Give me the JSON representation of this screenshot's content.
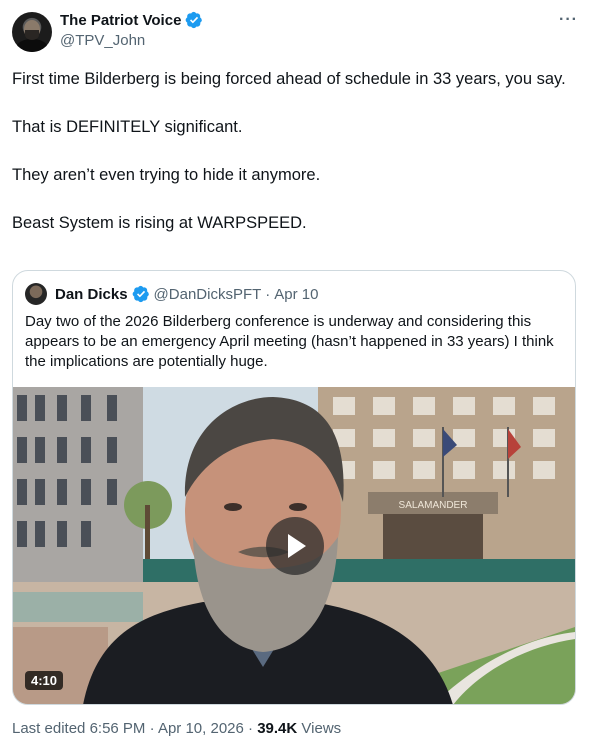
{
  "author": {
    "display_name": "The Patriot Voice",
    "handle": "@TPV_John",
    "verified_icon": "verified-badge-icon",
    "more_icon": "ellipsis-icon"
  },
  "tweet": {
    "paragraphs": [
      "First time Bilderberg is being forced ahead of schedule in 33 years, you say.",
      "That is DEFINITELY significant.",
      "They aren’t even trying to hide it anymore.",
      "Beast System is rising at WARPSPEED."
    ]
  },
  "quote": {
    "display_name": "Dan Dicks",
    "handle": "@DanDicksPFT",
    "separator": "·",
    "date": "Apr 10",
    "text": "Day two of the 2026 Bilderberg conference is underway and considering this appears to be an emergency April meeting (hasn’t happened in 33 years) I think the implications are potentially huge.",
    "video": {
      "duration": "4:10",
      "sign_text": "SALAMANDER",
      "play_icon": "play-icon"
    }
  },
  "footer": {
    "edited_label": "Last edited",
    "time": "6:56 PM",
    "separator": "·",
    "date": "Apr 10, 2026",
    "separator2": "·",
    "views_count": "39.4K",
    "views_label": "Views"
  },
  "colors": {
    "verified_blue": "#1d9bf0",
    "secondary_text": "#536471",
    "border": "#cfd9de"
  }
}
